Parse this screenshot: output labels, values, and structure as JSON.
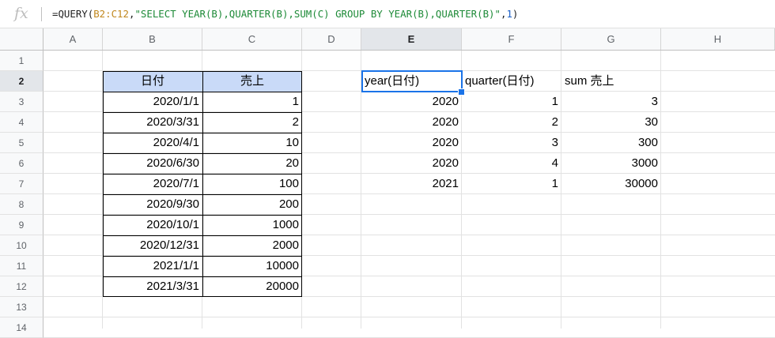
{
  "formula_bar": {
    "fx_label": "fx",
    "formula": {
      "prefix": "=QUERY(",
      "range": "B2:C12",
      "comma1": ",",
      "query_string": "\"SELECT YEAR(B),QUARTER(B),SUM(C) GROUP BY YEAR(B),QUARTER(B)\"",
      "comma2": ",",
      "headers_arg": "1",
      "suffix": ")"
    }
  },
  "columns": [
    "A",
    "B",
    "C",
    "D",
    "E",
    "F",
    "G",
    "H"
  ],
  "selected_column": "E",
  "rows": [
    "1",
    "2",
    "3",
    "4",
    "5",
    "6",
    "7",
    "8",
    "9",
    "10",
    "11",
    "12",
    "13",
    "14"
  ],
  "selected_row": "2",
  "source_table": {
    "headers": [
      "日付",
      "売上"
    ],
    "rows": [
      [
        "2020/1/1",
        "1"
      ],
      [
        "2020/3/31",
        "2"
      ],
      [
        "2020/4/1",
        "10"
      ],
      [
        "2020/6/30",
        "20"
      ],
      [
        "2020/7/1",
        "100"
      ],
      [
        "2020/9/30",
        "200"
      ],
      [
        "2020/10/1",
        "1000"
      ],
      [
        "2020/12/31",
        "2000"
      ],
      [
        "2021/1/1",
        "10000"
      ],
      [
        "2021/3/31",
        "20000"
      ]
    ],
    "header_color": "#c9daf8"
  },
  "query_result": {
    "headers": [
      "year(日付)",
      "quarter(日付)",
      "sum 売上"
    ],
    "rows": [
      [
        "2020",
        "1",
        "3"
      ],
      [
        "2020",
        "2",
        "30"
      ],
      [
        "2020",
        "3",
        "300"
      ],
      [
        "2020",
        "4",
        "3000"
      ],
      [
        "2021",
        "1",
        "30000"
      ]
    ]
  },
  "selected_cell": "E2",
  "accent_color": "#1a73e8"
}
